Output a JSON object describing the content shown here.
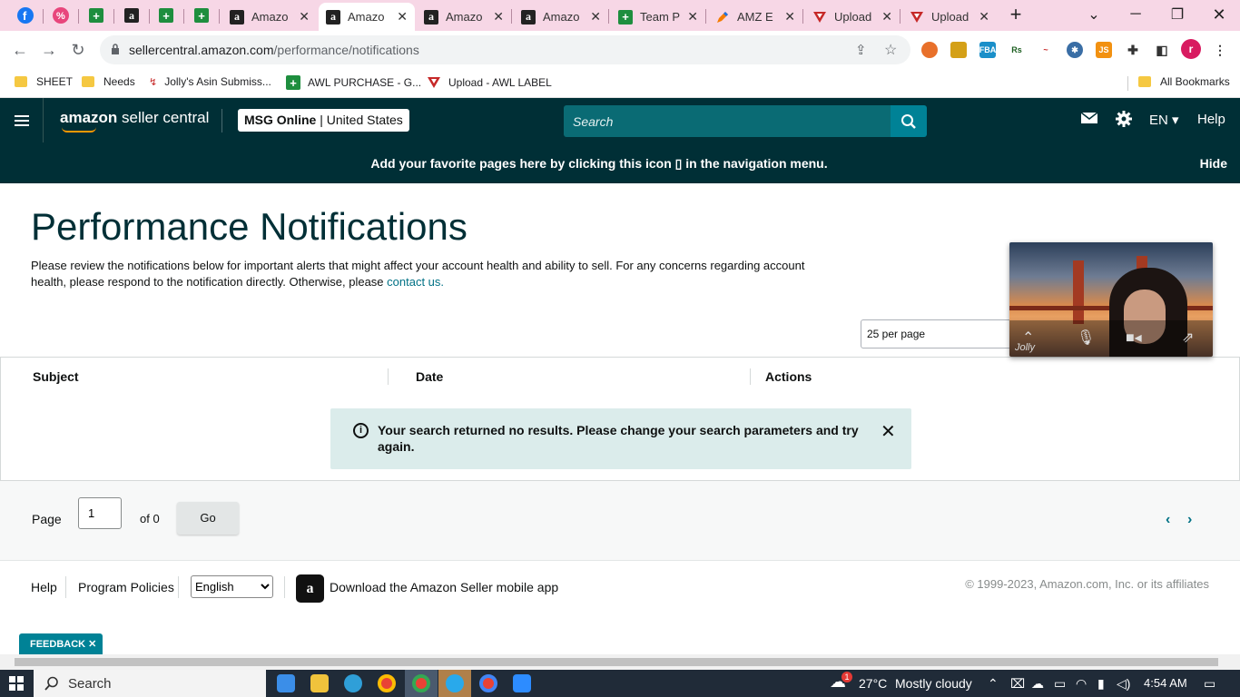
{
  "browser": {
    "tabs": [
      {
        "label": "Amazo",
        "icon": "amazon-icon",
        "active": false
      },
      {
        "label": "Amazo",
        "icon": "amazon-icon",
        "active": true
      },
      {
        "label": "Amazo",
        "icon": "amazon-icon",
        "active": false
      },
      {
        "label": "Amazo",
        "icon": "amazon-icon",
        "active": false
      },
      {
        "label": "Team P",
        "icon": "sheets-icon",
        "active": false
      },
      {
        "label": "AMZ E",
        "icon": "pencil-icon",
        "active": false
      },
      {
        "label": "Upload",
        "icon": "upload-triangle-icon",
        "active": false
      },
      {
        "label": "Upload",
        "icon": "upload-triangle-icon",
        "active": false
      }
    ],
    "url_host": "sellercentral.amazon.com",
    "url_path": "/performance/notifications",
    "bookmarks": [
      {
        "label": "SHEET",
        "icon": "folder-icon"
      },
      {
        "label": "Needs",
        "icon": "folder-icon"
      },
      {
        "label": "Jolly's Asin Submiss...",
        "icon": "link-icon"
      },
      {
        "label": "AWL PURCHASE - G...",
        "icon": "sheets-icon"
      },
      {
        "label": "Upload - AWL LABEL",
        "icon": "upload-triangle-icon"
      }
    ],
    "all_bookmarks": "All Bookmarks",
    "profile_initial": "r"
  },
  "header": {
    "logo_bold": "amazon",
    "logo_rest": " seller central",
    "store_name": "MSG Online",
    "store_region": " | United States",
    "search_placeholder": "Search",
    "lang": "EN",
    "help": "Help"
  },
  "favorites_banner": {
    "message": "Add your favorite pages here by clicking this icon",
    "message_end": "in the navigation menu.",
    "hide": "Hide"
  },
  "page": {
    "title": "Performance Notifications",
    "description": "Please review the notifications below for important alerts that might affect your account health and ability to sell. For any concerns regarding account health, please respond to the notification directly. Otherwise, please ",
    "contact_link": "contact us.",
    "per_page": "25 per page"
  },
  "table": {
    "columns": [
      "Subject",
      "Date",
      "Actions"
    ],
    "empty_message": "Your search returned no results. Please change your search parameters and try again."
  },
  "pager": {
    "label": "Page",
    "page_value": "1",
    "of_text": "of 0",
    "go": "Go"
  },
  "footer": {
    "help": "Help",
    "policies": "Program Policies",
    "language": "English",
    "app_text": "Download the Amazon Seller mobile app",
    "copyright": "© 1999-2023, Amazon.com, Inc. or its affiliates",
    "feedback": "FEEDBACK"
  },
  "video": {
    "name": "Jolly"
  },
  "taskbar": {
    "search": "Search",
    "weather_temp": "27°C",
    "weather_desc": "Mostly cloudy",
    "time": "4:54 AM",
    "notif_count": "1"
  },
  "colors": {
    "header_bg": "#002f36",
    "link": "#007185",
    "alert_bg": "#dbeceb",
    "tab_strip": "#f7d7e6"
  }
}
